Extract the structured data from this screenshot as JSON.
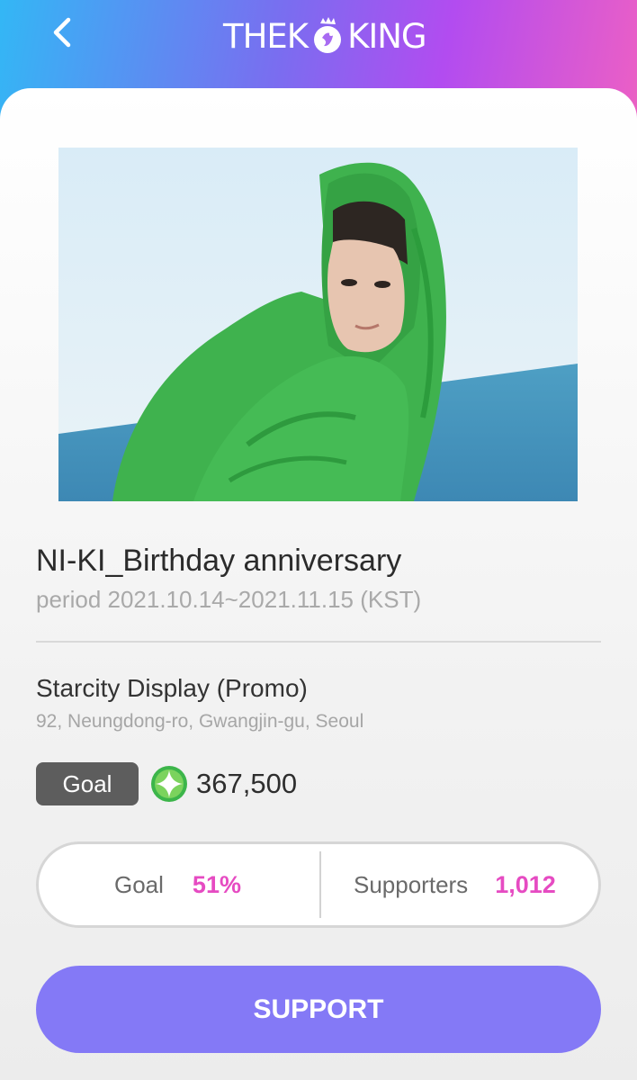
{
  "header": {
    "logo_left": "THEK",
    "logo_right": "KING",
    "back_icon": "chevron-left-icon"
  },
  "project": {
    "title": "NI-KI_Birthday anniversary",
    "period": "period 2021.10.14~2021.11.15 (KST)"
  },
  "venue": {
    "name": "Starcity Display (Promo)",
    "address": "92, Neungdong-ro, Gwangjin-gu, Seoul"
  },
  "goal": {
    "badge_label": "Goal",
    "amount": "367,500",
    "currency_icon": "green-star-icon"
  },
  "stats": {
    "goal_label": "Goal",
    "goal_value": "51%",
    "supporters_label": "Supporters",
    "supporters_value": "1,012"
  },
  "actions": {
    "support_label": "SUPPORT"
  },
  "colors": {
    "accent_pink": "#e64bc2",
    "button_purple": "#8479f6",
    "badge_gray": "#5d5d5d"
  }
}
